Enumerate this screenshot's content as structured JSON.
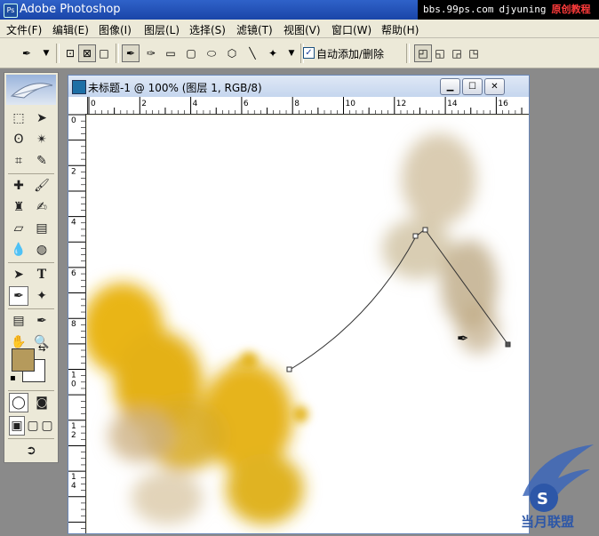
{
  "app": {
    "title": "Adobe Photoshop"
  },
  "watermark": {
    "site": "bbs.99ps.com",
    "author": "djyuning",
    "label": "原创教程"
  },
  "menubar": {
    "items": [
      "文件(F)",
      "编辑(E)",
      "图像(I)",
      "图层(L)",
      "选择(S)",
      "滤镜(T)",
      "视图(V)",
      "窗口(W)",
      "帮助(H)"
    ]
  },
  "options": {
    "auto_add_delete_label": "自动添加/删除",
    "auto_add_delete_checked": true
  },
  "document": {
    "title": "未标题-1 @ 100% (图层 1, RGB/8)",
    "h_ruler_labels": [
      "0",
      "2",
      "4",
      "6",
      "8",
      "10",
      "12",
      "14",
      "16"
    ],
    "v_ruler_labels": [
      "0",
      "2",
      "4",
      "6",
      "8",
      "1\n0",
      "1\n2",
      "1\n4"
    ]
  },
  "tools": {
    "foreground_color": "#b59a5c",
    "background_color": "#ffffff",
    "active_tool": "pen"
  },
  "logo": {
    "text": "当月联盟"
  }
}
